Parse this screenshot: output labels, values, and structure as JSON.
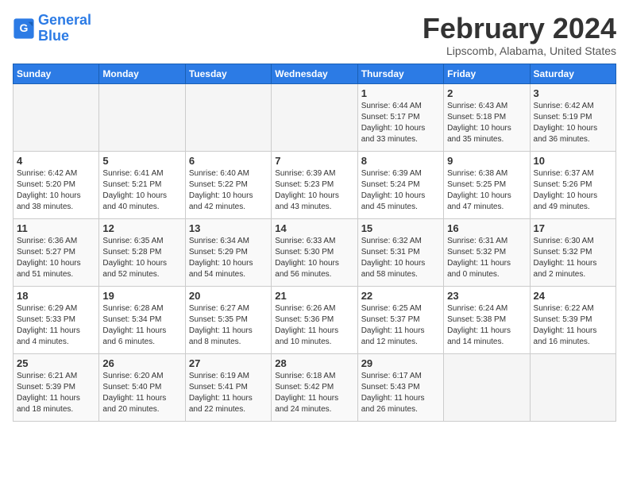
{
  "header": {
    "logo_line1": "General",
    "logo_line2": "Blue",
    "title": "February 2024",
    "subtitle": "Lipscomb, Alabama, United States"
  },
  "days_of_week": [
    "Sunday",
    "Monday",
    "Tuesday",
    "Wednesday",
    "Thursday",
    "Friday",
    "Saturday"
  ],
  "weeks": [
    [
      {
        "day": "",
        "info": ""
      },
      {
        "day": "",
        "info": ""
      },
      {
        "day": "",
        "info": ""
      },
      {
        "day": "",
        "info": ""
      },
      {
        "day": "1",
        "info": "Sunrise: 6:44 AM\nSunset: 5:17 PM\nDaylight: 10 hours\nand 33 minutes."
      },
      {
        "day": "2",
        "info": "Sunrise: 6:43 AM\nSunset: 5:18 PM\nDaylight: 10 hours\nand 35 minutes."
      },
      {
        "day": "3",
        "info": "Sunrise: 6:42 AM\nSunset: 5:19 PM\nDaylight: 10 hours\nand 36 minutes."
      }
    ],
    [
      {
        "day": "4",
        "info": "Sunrise: 6:42 AM\nSunset: 5:20 PM\nDaylight: 10 hours\nand 38 minutes."
      },
      {
        "day": "5",
        "info": "Sunrise: 6:41 AM\nSunset: 5:21 PM\nDaylight: 10 hours\nand 40 minutes."
      },
      {
        "day": "6",
        "info": "Sunrise: 6:40 AM\nSunset: 5:22 PM\nDaylight: 10 hours\nand 42 minutes."
      },
      {
        "day": "7",
        "info": "Sunrise: 6:39 AM\nSunset: 5:23 PM\nDaylight: 10 hours\nand 43 minutes."
      },
      {
        "day": "8",
        "info": "Sunrise: 6:39 AM\nSunset: 5:24 PM\nDaylight: 10 hours\nand 45 minutes."
      },
      {
        "day": "9",
        "info": "Sunrise: 6:38 AM\nSunset: 5:25 PM\nDaylight: 10 hours\nand 47 minutes."
      },
      {
        "day": "10",
        "info": "Sunrise: 6:37 AM\nSunset: 5:26 PM\nDaylight: 10 hours\nand 49 minutes."
      }
    ],
    [
      {
        "day": "11",
        "info": "Sunrise: 6:36 AM\nSunset: 5:27 PM\nDaylight: 10 hours\nand 51 minutes."
      },
      {
        "day": "12",
        "info": "Sunrise: 6:35 AM\nSunset: 5:28 PM\nDaylight: 10 hours\nand 52 minutes."
      },
      {
        "day": "13",
        "info": "Sunrise: 6:34 AM\nSunset: 5:29 PM\nDaylight: 10 hours\nand 54 minutes."
      },
      {
        "day": "14",
        "info": "Sunrise: 6:33 AM\nSunset: 5:30 PM\nDaylight: 10 hours\nand 56 minutes."
      },
      {
        "day": "15",
        "info": "Sunrise: 6:32 AM\nSunset: 5:31 PM\nDaylight: 10 hours\nand 58 minutes."
      },
      {
        "day": "16",
        "info": "Sunrise: 6:31 AM\nSunset: 5:32 PM\nDaylight: 11 hours\nand 0 minutes."
      },
      {
        "day": "17",
        "info": "Sunrise: 6:30 AM\nSunset: 5:32 PM\nDaylight: 11 hours\nand 2 minutes."
      }
    ],
    [
      {
        "day": "18",
        "info": "Sunrise: 6:29 AM\nSunset: 5:33 PM\nDaylight: 11 hours\nand 4 minutes."
      },
      {
        "day": "19",
        "info": "Sunrise: 6:28 AM\nSunset: 5:34 PM\nDaylight: 11 hours\nand 6 minutes."
      },
      {
        "day": "20",
        "info": "Sunrise: 6:27 AM\nSunset: 5:35 PM\nDaylight: 11 hours\nand 8 minutes."
      },
      {
        "day": "21",
        "info": "Sunrise: 6:26 AM\nSunset: 5:36 PM\nDaylight: 11 hours\nand 10 minutes."
      },
      {
        "day": "22",
        "info": "Sunrise: 6:25 AM\nSunset: 5:37 PM\nDaylight: 11 hours\nand 12 minutes."
      },
      {
        "day": "23",
        "info": "Sunrise: 6:24 AM\nSunset: 5:38 PM\nDaylight: 11 hours\nand 14 minutes."
      },
      {
        "day": "24",
        "info": "Sunrise: 6:22 AM\nSunset: 5:39 PM\nDaylight: 11 hours\nand 16 minutes."
      }
    ],
    [
      {
        "day": "25",
        "info": "Sunrise: 6:21 AM\nSunset: 5:39 PM\nDaylight: 11 hours\nand 18 minutes."
      },
      {
        "day": "26",
        "info": "Sunrise: 6:20 AM\nSunset: 5:40 PM\nDaylight: 11 hours\nand 20 minutes."
      },
      {
        "day": "27",
        "info": "Sunrise: 6:19 AM\nSunset: 5:41 PM\nDaylight: 11 hours\nand 22 minutes."
      },
      {
        "day": "28",
        "info": "Sunrise: 6:18 AM\nSunset: 5:42 PM\nDaylight: 11 hours\nand 24 minutes."
      },
      {
        "day": "29",
        "info": "Sunrise: 6:17 AM\nSunset: 5:43 PM\nDaylight: 11 hours\nand 26 minutes."
      },
      {
        "day": "",
        "info": ""
      },
      {
        "day": "",
        "info": ""
      }
    ]
  ]
}
